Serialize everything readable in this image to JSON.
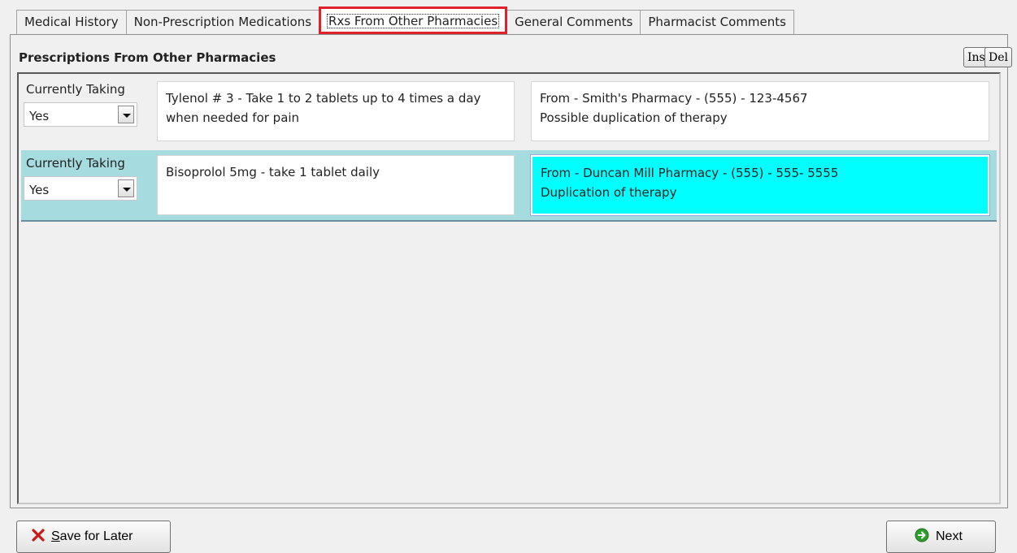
{
  "tabs": [
    {
      "label": "Medical History"
    },
    {
      "label": "Non-Prescription Medications"
    },
    {
      "label": "Rxs From Other Pharmacies"
    },
    {
      "label": "General Comments"
    },
    {
      "label": "Pharmacist Comments"
    }
  ],
  "active_tab": "Rxs From Other Pharmacies",
  "panel": {
    "title": "Prescriptions From Other Pharmacies",
    "ins_label": "Ins",
    "del_label": "Del"
  },
  "rows": [
    {
      "currently_taking_label": "Currently Taking",
      "currently_taking_value": "Yes",
      "description": "Tylenol # 3 - Take 1 to 2 tablets up to 4 times a day when needed for pain",
      "notes": "From - Smith's Pharmacy - (555) - 123-4567\nPossible duplication of therapy"
    },
    {
      "currently_taking_label": "Currently Taking",
      "currently_taking_value": "Yes",
      "description": "Bisoprolol 5mg - take 1 tablet daily",
      "notes": "From - Duncan Mill Pharmacy - (555) - 555- 5555\nDuplication of therapy"
    }
  ],
  "footer": {
    "save_label_first": "S",
    "save_label_rest": "ave for Later",
    "next_label": "Next"
  },
  "colors": {
    "active_tab_border": "#e0202a",
    "selected_row": "#a6dbe0",
    "highlight_field": "#00ffff",
    "save_icon": "#cc1a1a",
    "next_icon": "#2e9e2e"
  },
  "icons": {
    "save": "close-x-icon",
    "next": "arrow-right-circle-icon"
  }
}
